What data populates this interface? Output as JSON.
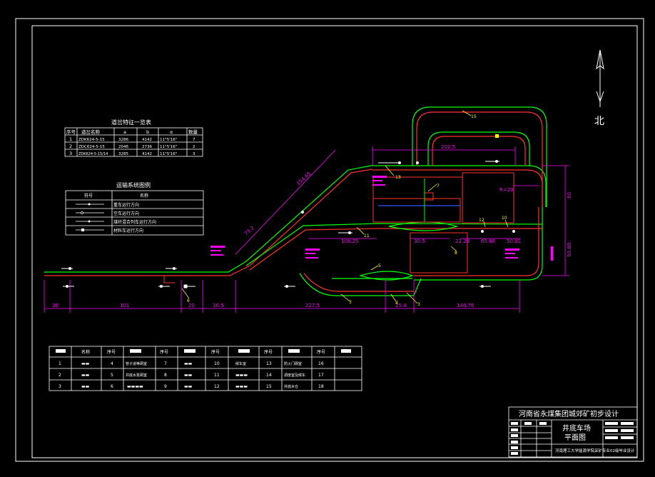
{
  "title_block": {
    "company": "河南省永煤集团城郊矿初步设计",
    "drawing_name_1": "井底车场",
    "drawing_name_2": "平面图",
    "school": "河南理工大学能源学院采矿专业02级毕业设计"
  },
  "turnout_table": {
    "title": "道岔特征一览表",
    "headers": [
      "序号",
      "道岔名称",
      "a",
      "b",
      "α",
      "数量"
    ],
    "rows": [
      [
        "1",
        "ZDK624-5-15",
        "3286",
        "4142",
        "11°5'16\"",
        "7"
      ],
      [
        "2",
        "ZDC624-5-15",
        "2046",
        "2736",
        "11°5'16\"",
        "2"
      ],
      [
        "3",
        "ZDK624-5-15/14",
        "3285",
        "4142",
        "11°5'16\"",
        "3"
      ]
    ]
  },
  "legend": {
    "title": "运输系统图例",
    "headers": [
      "符号",
      "名称"
    ],
    "items": [
      "重车运行方向",
      "空车运行方向",
      "煤矸混合列车运行方向",
      "材料车运行方向"
    ]
  },
  "chamber_table": {
    "row1": [
      "名称",
      "序号",
      "序号",
      "序号",
      "序号"
    ],
    "items": [
      {
        "n": "1",
        "name": "▬▬"
      },
      {
        "n": "2",
        "name": "▬▬"
      },
      {
        "n": "3",
        "name": "▬▬"
      },
      {
        "n": "4",
        "name": "管子道等硐室"
      },
      {
        "n": "5",
        "name": "井底水泵硐室"
      },
      {
        "n": "6",
        "name": "▬▬▬▬"
      },
      {
        "n": "7",
        "name": "▬▬"
      },
      {
        "n": "8",
        "name": "▬▬"
      },
      {
        "n": "9",
        "name": "▬▬"
      },
      {
        "n": "10",
        "name": "候车室"
      },
      {
        "n": "11",
        "name": "▬▬▬"
      },
      {
        "n": "12",
        "name": "▬▬▬"
      },
      {
        "n": "13",
        "name": "防火门硐室"
      },
      {
        "n": "14",
        "name": "调度室及候车"
      },
      {
        "n": "15",
        "name": "井底水仓"
      },
      {
        "n": "16",
        "name": ""
      },
      {
        "n": "17",
        "name": ""
      },
      {
        "n": "18",
        "name": ""
      }
    ]
  },
  "dimensions": {
    "d1": "30",
    "d2": "101",
    "d3": "20",
    "d4": "36.5",
    "d5": "227.5",
    "d6": "25.4",
    "d7": "146.76",
    "d8": "202.5",
    "d9": "154.65",
    "d10": "73.2",
    "d11": "60",
    "d12": "R=20",
    "d13": "50.88",
    "d14": "50.01",
    "d15": "106.25",
    "d16": "22.28",
    "d17": "65.60",
    "d18": "30.5"
  },
  "labels": {
    "north": "北"
  },
  "colors": {
    "frame": "#ffffff",
    "track_green": "#00ff00",
    "track_red": "#ff3030",
    "dimension": "#ff00ff",
    "leader": "#ffff00",
    "blue": "#3355ff"
  }
}
